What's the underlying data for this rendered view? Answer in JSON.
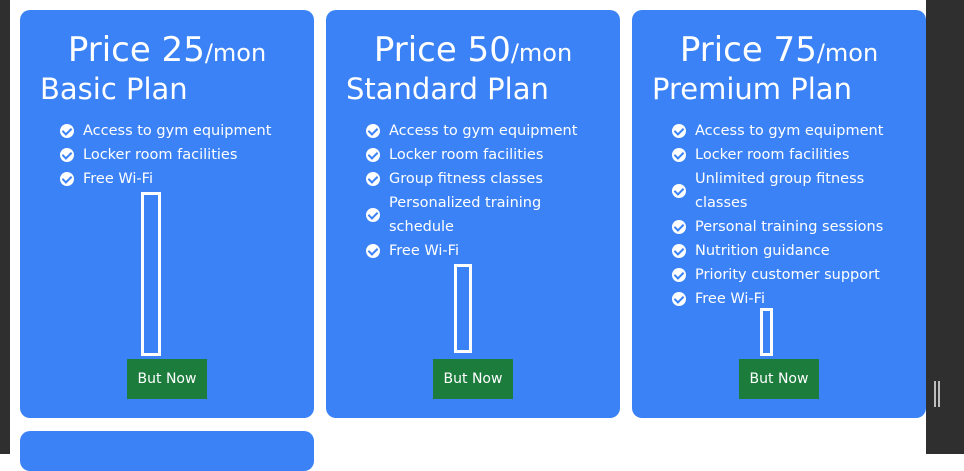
{
  "plans": [
    {
      "price_label": "Price 25",
      "per_label": "/mon",
      "name": "Basic Plan",
      "features": [
        "Access to gym equipment",
        "Locker room facilities",
        "Free Wi-Fi"
      ],
      "button_label": "But Now"
    },
    {
      "price_label": "Price 50",
      "per_label": "/mon",
      "name": "Standard Plan",
      "features": [
        "Access to gym equipment",
        "Locker room facilities",
        "Group fitness classes",
        "Personalized training schedule",
        "Free Wi-Fi"
      ],
      "button_label": "But Now"
    },
    {
      "price_label": "Price 75",
      "per_label": "/mon",
      "name": "Premium Plan",
      "features": [
        "Access to gym equipment",
        "Locker room facilities",
        "Unlimited group fitness classes",
        "Personal training sessions",
        "Nutrition guidance",
        "Priority customer support",
        "Free Wi-Fi"
      ],
      "button_label": "But Now"
    }
  ],
  "colors": {
    "card_background": "#3b82f6",
    "button_background": "#1c7c3c",
    "text": "#ffffff",
    "outer_frame": "#2f2f2f"
  },
  "icons": {
    "feature_bullet": "check-circle-icon"
  }
}
